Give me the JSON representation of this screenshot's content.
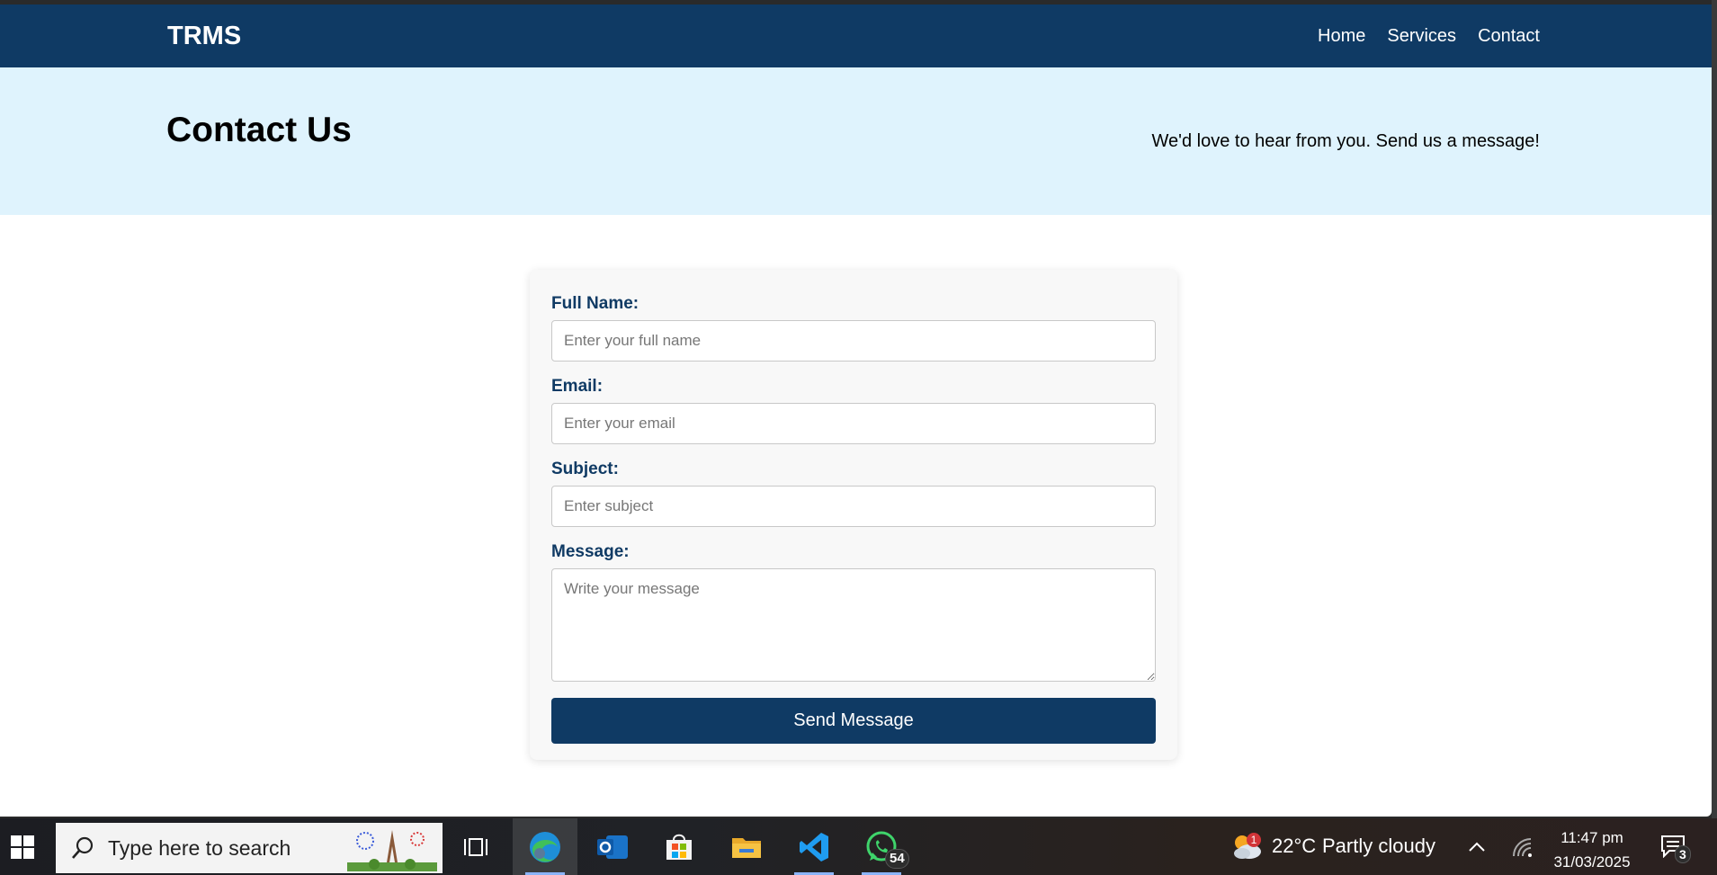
{
  "header": {
    "logo": "TRMS",
    "nav": [
      "Home",
      "Services",
      "Contact"
    ]
  },
  "hero": {
    "title": "Contact Us",
    "tagline": "We'd love to hear from you. Send us a message!"
  },
  "form": {
    "full_name": {
      "label": "Full Name:",
      "placeholder": "Enter your full name",
      "value": ""
    },
    "email": {
      "label": "Email:",
      "placeholder": "Enter your email",
      "value": ""
    },
    "subject": {
      "label": "Subject:",
      "placeholder": "Enter subject",
      "value": ""
    },
    "message": {
      "label": "Message:",
      "placeholder": "Write your message",
      "value": ""
    },
    "submit_label": "Send Message"
  },
  "taskbar": {
    "search_placeholder": "Type here to search",
    "apps": [
      "task-view-icon",
      "edge-icon",
      "outlook-icon",
      "store-icon",
      "file-explorer-icon",
      "vscode-icon",
      "whatsapp-icon"
    ],
    "whatsapp_badge": "54",
    "weather": {
      "temp": "22°C",
      "condition": "Partly cloudy",
      "badge": "1"
    },
    "time": "11:47 pm",
    "date": "31/03/2025",
    "notifications_count": "3"
  },
  "colors": {
    "primary": "#0f3a64",
    "hero_bg": "#dff3fd",
    "card_bg": "#f8f8f8"
  }
}
